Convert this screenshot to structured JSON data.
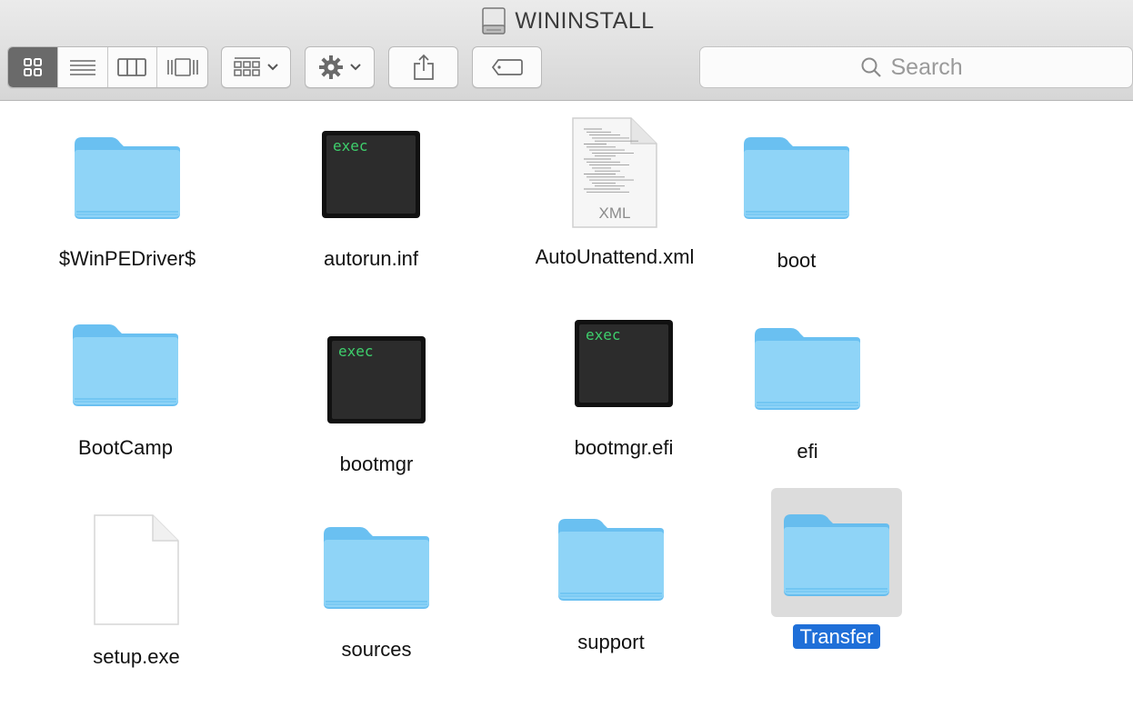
{
  "window": {
    "title": "WININSTALL"
  },
  "toolbar": {
    "view_modes": [
      {
        "name": "icon-view",
        "active": true
      },
      {
        "name": "list-view",
        "active": false
      },
      {
        "name": "column-view",
        "active": false
      },
      {
        "name": "cover-flow-view",
        "active": false
      }
    ],
    "arrange_icon": "arrange-grid-icon",
    "action_icon": "gear-icon",
    "share_icon": "share-icon",
    "tag_icon": "tag-icon",
    "search_placeholder": "Search"
  },
  "files": [
    {
      "name": "$WinPEDriver$",
      "kind": "folder"
    },
    {
      "name": "autorun.inf",
      "kind": "exec",
      "badge": "exec"
    },
    {
      "name": "AutoUnattend.xml",
      "kind": "xml",
      "badge": "XML"
    },
    {
      "name": "boot",
      "kind": "folder"
    },
    {
      "name": "BootCamp",
      "kind": "folder"
    },
    {
      "name": "bootmgr",
      "kind": "exec",
      "badge": "exec"
    },
    {
      "name": "bootmgr.efi",
      "kind": "exec",
      "badge": "exec"
    },
    {
      "name": "efi",
      "kind": "folder"
    },
    {
      "name": "setup.exe",
      "kind": "document"
    },
    {
      "name": "sources",
      "kind": "folder"
    },
    {
      "name": "support",
      "kind": "folder"
    },
    {
      "name": "Transfer",
      "kind": "folder",
      "selected": true
    }
  ],
  "colors": {
    "folder_top": "#8fd4f7",
    "folder_bottom": "#5ab9ef",
    "selection": "#1f6fd8",
    "exec_text": "#3ecf6c"
  }
}
